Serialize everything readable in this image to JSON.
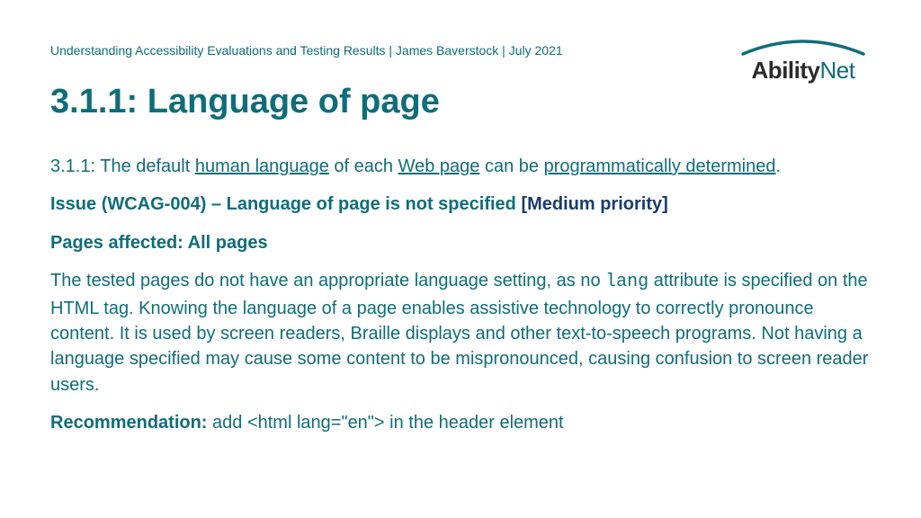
{
  "header": {
    "breadcrumb": "Understanding Accessibility Evaluations and Testing Results | James Baverstock | July 2021"
  },
  "logo": {
    "brand_a": "Ability",
    "brand_b": "Net"
  },
  "title": "3.1.1: Language of page",
  "criterion": {
    "prefix": "3.1.1: The default ",
    "link1": "human language",
    "mid1": " of each ",
    "link2": "Web page",
    "mid2": " can be ",
    "link3": "programmatically determined",
    "suffix": "."
  },
  "issue": {
    "title": "Issue (WCAG-004) – Language of page is not specified ",
    "priority": "[Medium priority]"
  },
  "pages_affected": "Pages affected: All pages",
  "description": {
    "part1": "The tested pages do not have an appropriate language setting, as no ",
    "code": "lang",
    "part2": " attribute is specified on the HTML tag. Knowing the language of a page enables assistive technology to correctly pronounce content. It is used by screen readers, Braille displays and other text-to-speech programs. Not having a language specified may cause some content to be mispronounced, causing confusion to screen reader users."
  },
  "recommendation": {
    "label": "Recommendation:",
    "text": " add <html lang=\"en\"> in the header element"
  }
}
